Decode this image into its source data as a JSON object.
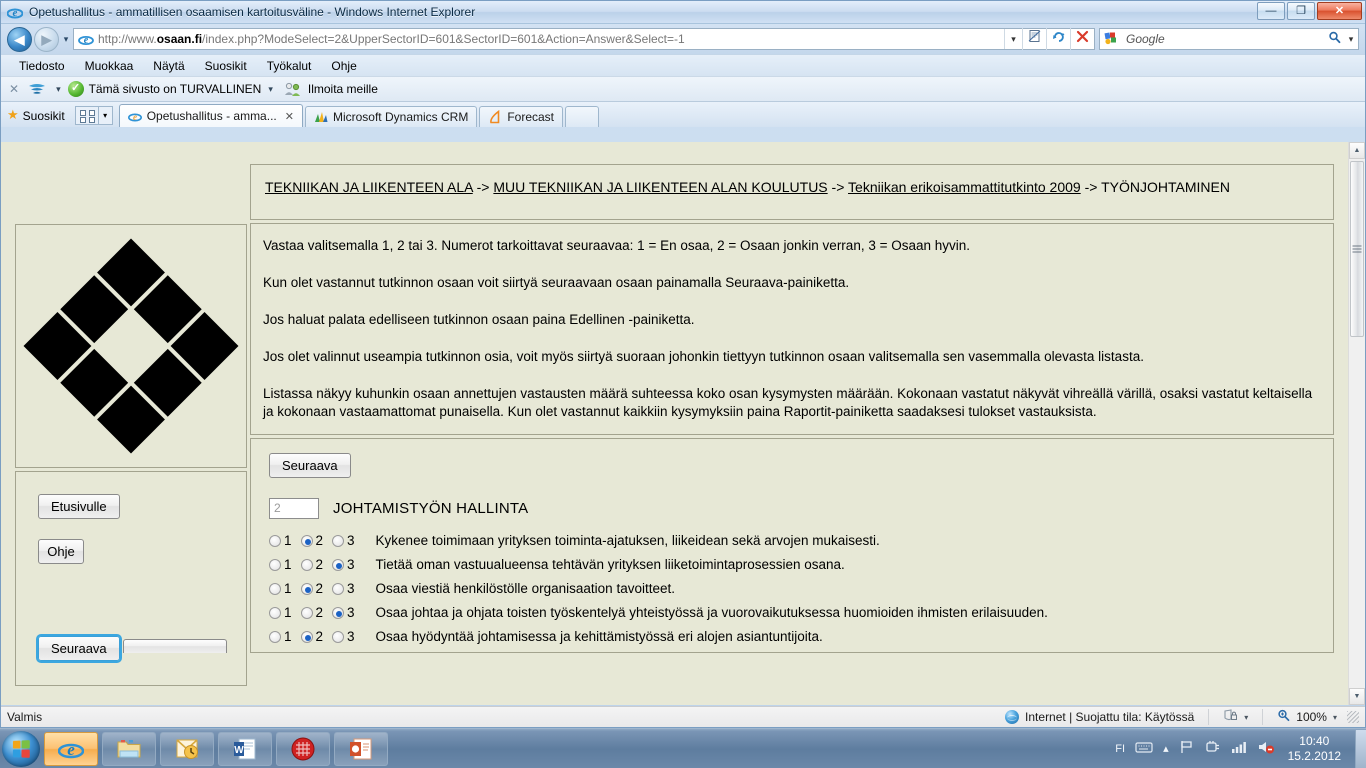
{
  "window": {
    "title": "Opetushallitus - ammatillisen osaamisen kartoitusväline - Windows Internet Explorer",
    "minimize_label": "—",
    "maximize_label": "❐",
    "close_label": "✕"
  },
  "navigation": {
    "back_label": "◀",
    "forward_label": "▶",
    "history_caret": "▾",
    "url": {
      "scheme": "http://www.",
      "host": "osaan.fi",
      "path": "/index.php?ModeSelect=2&UpperSectorID=601&SectorID=601&Action=Answer&Select=-1",
      "full": "http://www.osaan.fi/index.php?ModeSelect=2&UpperSectorID=601&SectorID=601&Action=Answer&Select=-1"
    },
    "url_dropdown": "▾",
    "compat_icon": "compatibility-view-icon",
    "refresh_icon": "↻",
    "stop_icon": "✕",
    "search": {
      "provider": "Google",
      "go_icon": "🔍",
      "dropdown": "▾"
    }
  },
  "menubar": {
    "items": [
      {
        "label": "Tiedosto"
      },
      {
        "label": "Muokkaa"
      },
      {
        "label": "Näytä"
      },
      {
        "label": "Suosikit"
      },
      {
        "label": "Työkalut"
      },
      {
        "label": "Ohje"
      }
    ]
  },
  "addonbar": {
    "close_label": "✕",
    "wave_caret": "▾",
    "security_label": "Tämä sivusto on TURVALLINEN",
    "security_caret": "▾",
    "report_label": "Ilmoita meille"
  },
  "favbar": {
    "star_icon": "★",
    "favorites_label": "Suosikit",
    "grid_caret": "▾"
  },
  "tabs": [
    {
      "label": "Opetushallitus - amma...",
      "close": "✕",
      "active": true,
      "icon": "ie-icon"
    },
    {
      "label": "Microsoft Dynamics CRM",
      "active": false,
      "icon": "crm-icon"
    },
    {
      "label": "Forecast",
      "active": false,
      "icon": "forecast-icon"
    }
  ],
  "page": {
    "breadcrumb": [
      {
        "text": "TEKNIIKAN JA LIIKENTEEN ALA",
        "link": true
      },
      {
        "text": " -> ",
        "link": false
      },
      {
        "text": "MUU TEKNIIKAN JA LIIKENTEEN ALAN KOULUTUS",
        "link": true
      },
      {
        "text": " -> ",
        "link": false
      },
      {
        "text": "Tekniikan erikoisammattitutkinto 2009",
        "link": true
      },
      {
        "text": " -> ",
        "link": false
      },
      {
        "text": "TYÖNJOHTAMINEN",
        "link": false
      }
    ],
    "logo_name": "osaan-diamond-logo",
    "intro_paragraphs": [
      "Vastaa valitsemalla 1, 2 tai 3. Numerot tarkoittavat seuraavaa: 1 = En osaa, 2 = Osaan jonkin verran, 3 = Osaan hyvin.",
      "Kun olet vastannut tutkinnon osaan voit siirtyä seuraavaan osaan painamalla Seuraava-painiketta.",
      "Jos haluat palata edelliseen tutkinnon osaan paina Edellinen -painiketta.",
      "Jos olet valinnut useampia tutkinnon osia, voit myös siirtyä suoraan johonkin tiettyyn tutkinnon osaan valitsemalla sen vasemmalla olevasta listasta.",
      "Listassa näkyy kuhunkin osaan annettujen vastausten määrä suhteessa koko osan kysymysten määrään. Kokonaan vastatut näkyvät vihreällä värillä, osaksi vastatut keltaisella ja kokonaan vastaamattomat punaisella. Kun olet vastannut kaikkiin kysymyksiin paina Raportit-painiketta saadaksesi tulokset vastauksista."
    ],
    "sidebar_buttons": [
      {
        "label": "Etusivulle",
        "focused": false
      },
      {
        "label": "Ohje",
        "focused": false
      },
      {
        "label": "Seuraava",
        "focused": true
      }
    ],
    "quiz": {
      "next_button": "Seuraava",
      "section_number": "2",
      "section_title": "JOHTAMISTYÖN HALLINTA",
      "options": [
        "1",
        "2",
        "3"
      ],
      "questions": [
        {
          "text": "Kykenee toimimaan yrityksen toiminta-ajatuksen, liikeidean sekä arvojen mukaisesti.",
          "selected": "2"
        },
        {
          "text": "Tietää oman vastuualueensa tehtävän yrityksen liiketoimintaprosessien osana.",
          "selected": "3"
        },
        {
          "text": "Osaa viestiä henkilöstölle organisaation tavoitteet.",
          "selected": "2"
        },
        {
          "text": "Osaa johtaa ja ohjata toisten työskentelyä yhteistyössä ja vuorovaikutuksessa huomioiden ihmisten erilaisuuden.",
          "selected": "3"
        },
        {
          "text": "Osaa hyödyntää johtamisessa ja kehittämistyössä eri alojen asiantuntijoita.",
          "selected": "2"
        }
      ]
    }
  },
  "statusbar": {
    "left_text": "Valmis",
    "zone_text": "Internet | Suojattu tila: Käytössä",
    "zone_caret": "▾",
    "zoom_level": "100%",
    "zoom_caret": "▾"
  },
  "taskbar": {
    "start_name": "start-orb",
    "items": [
      {
        "name": "internet-explorer-taskbar-item",
        "active": true
      },
      {
        "name": "windows-explorer-taskbar-item",
        "active": false
      },
      {
        "name": "outlook-taskbar-item",
        "active": false
      },
      {
        "name": "word-taskbar-item",
        "active": false
      },
      {
        "name": "red-app-taskbar-item",
        "active": false
      },
      {
        "name": "powerpoint-taskbar-item",
        "active": false
      }
    ],
    "tray": {
      "language": "FI",
      "expand_caret": "▴",
      "time": "10:40",
      "date": "15.2.2012"
    }
  }
}
